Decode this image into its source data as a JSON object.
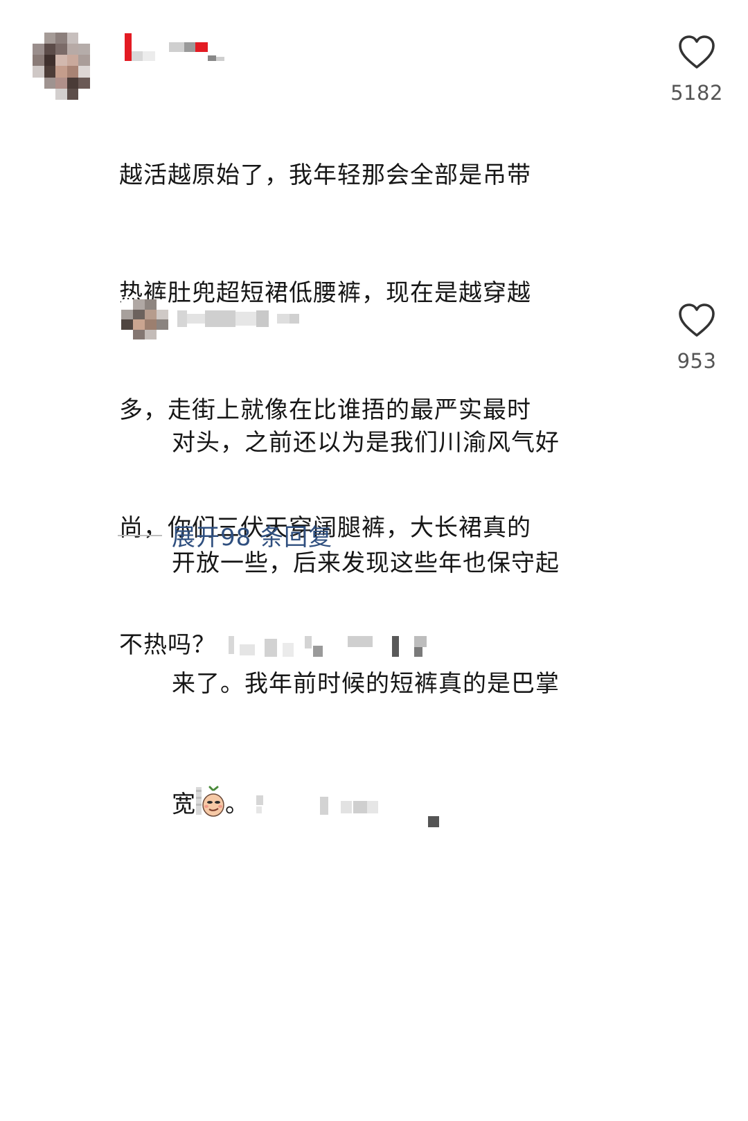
{
  "comment": {
    "text_lines": [
      "越活越原始了，我年轻那会全部是吊带",
      "热裤肚兜超短裙低腰裤，现在是越穿越",
      "多，走街上就像在比谁捂的最严实最时",
      "尚，你们三伏天穿阔腿裤，大长裙真的",
      "不热吗？"
    ],
    "like_count": "5182",
    "like_icon": "heart-outline-icon"
  },
  "reply": {
    "text_lines": [
      "对头，之前还以为是我们川渝风气好",
      "开放一些，后来发现这些年也保守起",
      "来了。我年前时候的短裤真的是巴掌",
      "宽"
    ],
    "tail_text": "。",
    "emoji": "smirk-face-emoji",
    "like_count": "953",
    "like_icon": "heart-outline-icon"
  },
  "expand": {
    "label": "展开98 条回复"
  },
  "colors": {
    "text": "#161616",
    "count": "#555555",
    "link": "#2f4f7f",
    "divider": "#bdbdbd"
  }
}
